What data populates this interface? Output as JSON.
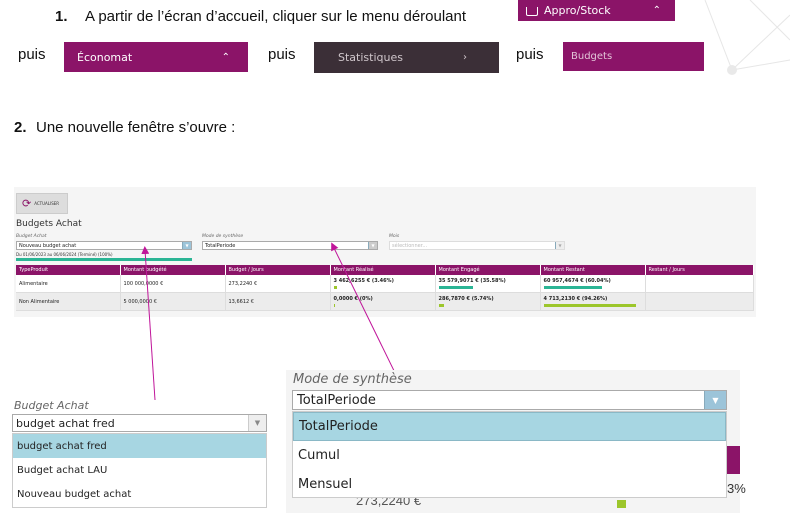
{
  "step1": {
    "num": "1.",
    "text": "A partir de l’écran d’accueil, cliquer sur le menu déroulant",
    "menu_appro": "Appro/Stock",
    "puis1": "puis",
    "menu_economat": "Économat",
    "puis2": "puis",
    "menu_statistiques": "Statistiques",
    "puis3": "puis",
    "menu_budgets": "Budgets"
  },
  "step2": {
    "num": "2.",
    "text": "Une nouvelle fenêtre s’ouvre :"
  },
  "screen": {
    "refresh_label": "ACTUALISER",
    "title": "Budgets Achat",
    "budget_label": "Budget Achat",
    "budget_value": "Nouveau budget achat",
    "period_text": "Du 01/06/2023 au 06/06/2024 (Terminé) (100%)",
    "mode_label": "Mode de synthèse",
    "mode_value": "TotalPeriode",
    "mois_label": "Mois",
    "mois_placeholder": "sélectionner...",
    "columns": [
      "TypeProduit",
      "Montant budgété",
      "Budget / Jours",
      "Montant Réalisé",
      "Montant Engagé",
      "Montant Restant",
      "Restant / Jours"
    ],
    "rows": [
      {
        "type": "Alimentaire",
        "budget": "100 000,0000 €",
        "per_day": "273,2240 €",
        "realise": "3 462,6255 € (3.46%)",
        "realise_pct": 3.46,
        "engage": "35 579,9071 € (35.58%)",
        "engage_pct": 35.58,
        "restant": "60 957,4674 € (60.04%)",
        "restant_pct": 60.04,
        "restant_jours": ""
      },
      {
        "type": "Non Alimentaire",
        "budget": "5 000,0000 €",
        "per_day": "13,6612 €",
        "realise": "0,0000 € (0%)",
        "realise_pct": 0,
        "engage": "286,7870 € (5.74%)",
        "engage_pct": 5.74,
        "restant": "4 713,2130 € (94.26%)",
        "restant_pct": 94.26,
        "restant_jours": ""
      }
    ]
  },
  "zoom_budget": {
    "label": "Budget Achat",
    "value": "budget achat fred",
    "options": [
      "budget achat fred",
      "Budget achat LAU",
      "Nouveau budget achat"
    ]
  },
  "zoom_mode": {
    "label": "Mode de synthèse",
    "value": "TotalPeriode",
    "options": [
      "TotalPeriode",
      "Cumul",
      "Mensuel"
    ],
    "peek_value": "273,2240 €",
    "peek_pct": "3%"
  },
  "colors": {
    "purple": "#8b1468",
    "dark_menu": "#3b2f37",
    "teal": "#2bb595",
    "green": "#9cc62b",
    "highlight": "#a7d6e2"
  }
}
